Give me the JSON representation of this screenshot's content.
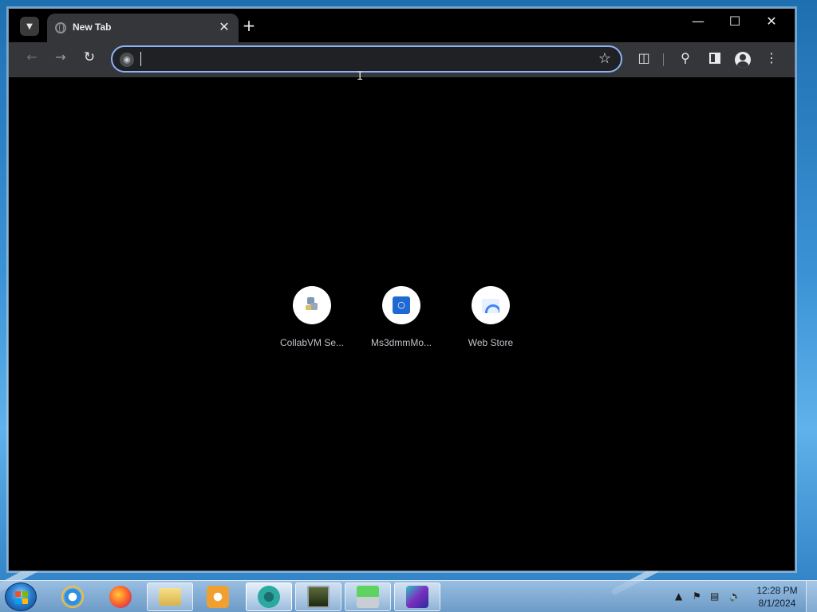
{
  "browser": {
    "tab": {
      "title": "New Tab"
    },
    "omnibox": {
      "value": "",
      "placeholder": ""
    },
    "shortcuts": [
      {
        "label": "CollabVM Se...",
        "icon": "collabvm-icon"
      },
      {
        "label": "Ms3dmmMo...",
        "icon": "ms3dmm-icon"
      },
      {
        "label": "Web Store",
        "icon": "web-store-icon"
      }
    ],
    "colors": {
      "toolbar": "#35363a",
      "tab_active": "#35363a",
      "omnibox_focus": "#8ab4f8",
      "content_bg": "#000000"
    }
  },
  "taskbar": {
    "apps": [
      {
        "name": "internet-explorer-icon",
        "open": false
      },
      {
        "name": "firefox-icon",
        "open": false
      },
      {
        "name": "file-explorer-icon",
        "open": true
      },
      {
        "name": "media-player-icon",
        "open": false
      },
      {
        "name": "chrome-browser-icon",
        "open": true,
        "active": true
      },
      {
        "name": "task-manager-icon",
        "open": true
      },
      {
        "name": "downloader-icon",
        "open": true
      },
      {
        "name": "3d-movie-maker-icon",
        "open": true
      }
    ],
    "clock": {
      "time": "12:28 PM",
      "date": "8/1/2024"
    }
  }
}
